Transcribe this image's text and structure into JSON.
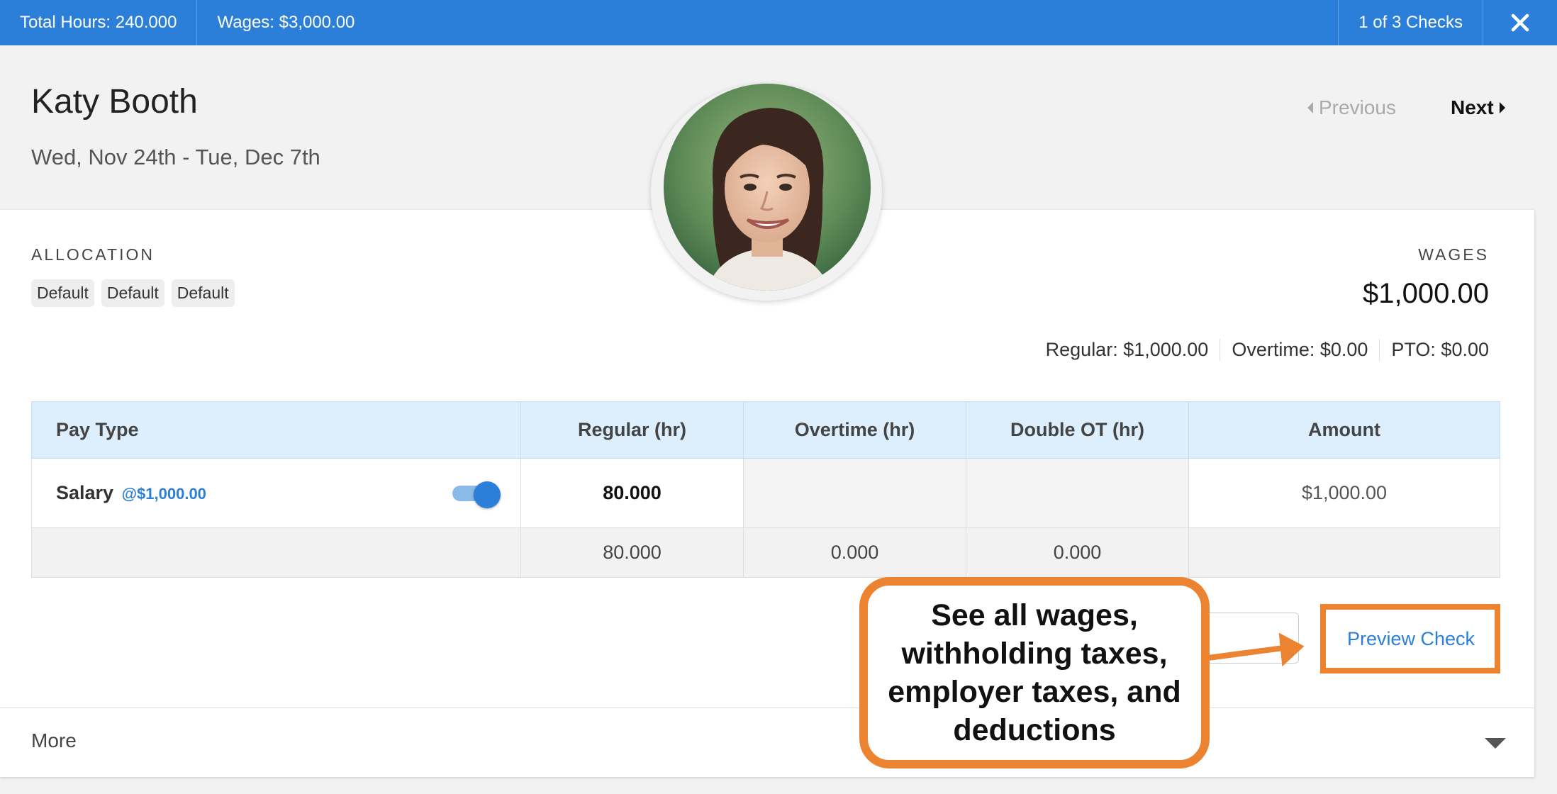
{
  "topbar": {
    "total_hours": "Total Hours: 240.000",
    "wages": "Wages: $3,000.00",
    "checks": "1 of 3 Checks",
    "close_icon": "✕"
  },
  "header": {
    "employee_name": "Katy Booth",
    "date_range": "Wed, Nov 24th - Tue, Dec 7th",
    "previous_label": "Previous",
    "next_label": "Next"
  },
  "allocation": {
    "label": "ALLOCATION",
    "chips": [
      "Default",
      "Default",
      "Default"
    ]
  },
  "wages": {
    "label": "WAGES",
    "amount": "$1,000.00",
    "regular": "Regular: $1,000.00",
    "overtime": "Overtime: $0.00",
    "pto": "PTO: $0.00"
  },
  "table": {
    "headers": [
      "Pay Type",
      "Regular (hr)",
      "Overtime (hr)",
      "Double OT (hr)",
      "Amount"
    ],
    "rows": [
      {
        "pay_type": "Salary",
        "rate": "@$1,000.00",
        "toggle_on": true,
        "regular": "80.000",
        "overtime": "",
        "double_ot": "",
        "amount": "$1,000.00"
      }
    ],
    "totals": {
      "regular": "80.000",
      "overtime": "0.000",
      "double_ot": "0.000"
    }
  },
  "actions": {
    "preview_check": "Preview Check"
  },
  "more": {
    "label": "More"
  },
  "callout": {
    "text": "See all wages, withholding taxes, employer taxes, and deductions"
  },
  "colors": {
    "primary": "#2b7fd8",
    "accent_orange": "#ec8331",
    "header_row": "#ddeefc"
  },
  "icons": {
    "close": "close-icon",
    "previous": "chevron-left-icon",
    "next": "chevron-right-icon",
    "more": "chevron-down-icon",
    "avatar": "avatar"
  }
}
